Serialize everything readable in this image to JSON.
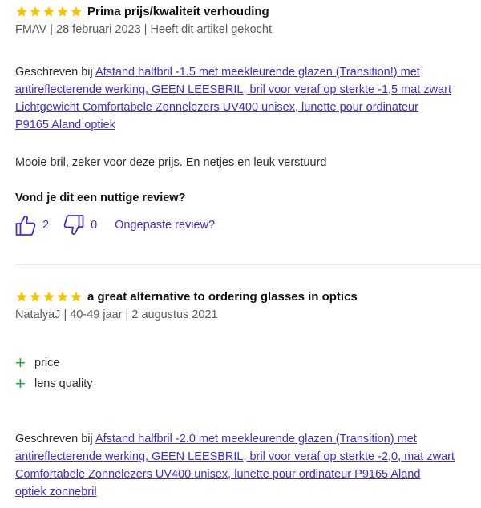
{
  "colors": {
    "star": "#f5c400",
    "link": "#3b2fd6",
    "plus": "#2aa43a"
  },
  "reviews": [
    {
      "rating": 5,
      "title": "Prima prijs/kwaliteit verhouding",
      "meta": "FMAV | 28 februari 2023 | Heeft dit artikel gekocht",
      "written_prefix": "Geschreven bij",
      "product_link_lines": [
        "Afstand halfbril -1.5 met meekleurende glazen (Transition!) met",
        "antireflecterende werking, GEEN LEESBRIL, bril voor veraf op sterkte -1,5 mat zwart",
        "Lichtgewicht Comfortabele Zonnelezers UV400 unisex, lunette pour ordinateur",
        "P9165 Aland optiek"
      ],
      "body": "Mooie bril, zeker voor deze prijs. En netjes en leuk verstuurd",
      "helpful_question": "Vond je dit een nuttige review?",
      "thumbs_up_count": "2",
      "thumbs_down_count": "0",
      "report_label": "Ongepaste review?",
      "icons": {
        "up": "thumbs-up-icon",
        "down": "thumbs-down-icon"
      }
    },
    {
      "rating": 5,
      "title": "a great alternative to ordering glasses in optics",
      "meta": "NatalyaJ | 40-49 jaar | 2 augustus 2021",
      "pros": [
        "price",
        "lens quality"
      ],
      "written_prefix": "Geschreven bij",
      "product_link_lines": [
        "Afstand halfbril -2.0 met meekleurende glazen (Transition) met",
        "antireflecterende werking, GEEN LEESBRIL, bril voor veraf op sterkte -2,0, mat zwart",
        "Comfortabele Zonnelezers UV400 unisex, lunette pour ordinateur P9165 Aland",
        "optiek zonnebril"
      ]
    }
  ]
}
